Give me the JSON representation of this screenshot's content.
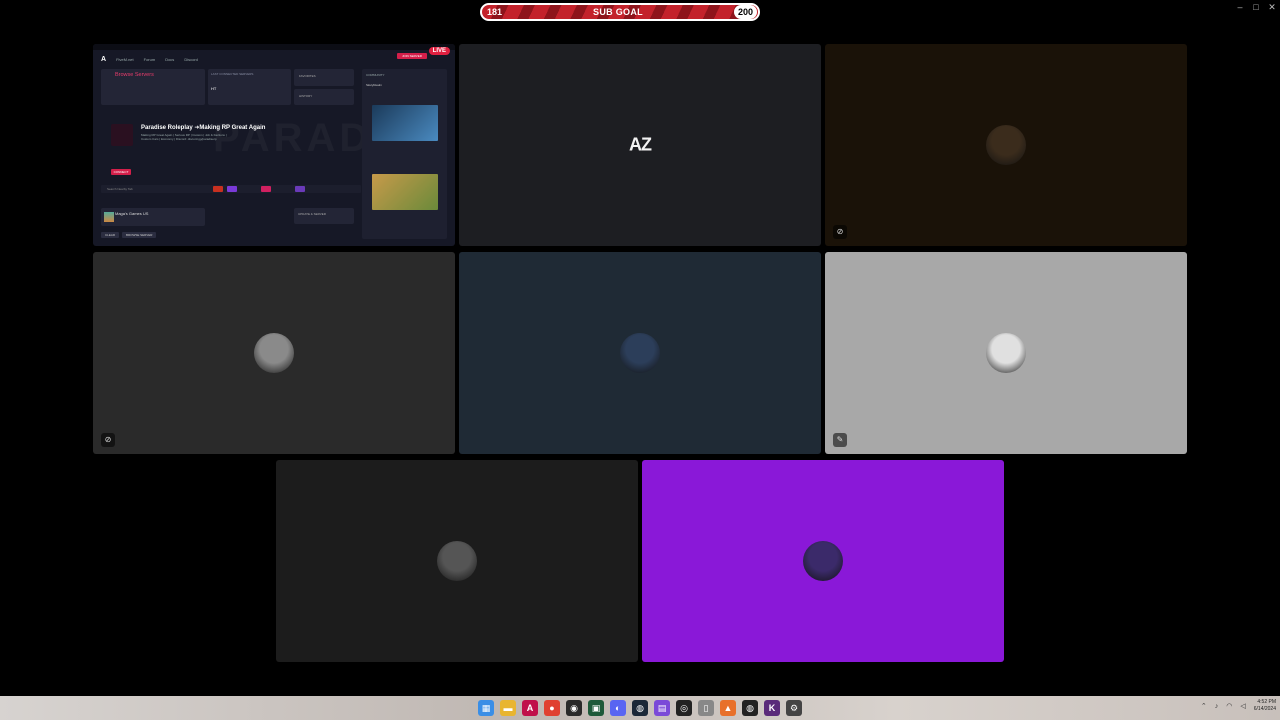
{
  "subgoal": {
    "current": "181",
    "title": "SUB GOAL",
    "target": "200"
  },
  "window_controls": {
    "minimize": "–",
    "maximize": "□",
    "close": "✕"
  },
  "screen_share": {
    "live_badge": "LIVE",
    "nav": [
      "FiveM.net",
      "Forum",
      "Docs",
      "Discord"
    ],
    "join_label": "JOIN SERVER",
    "browse_label": "Browse Servers",
    "recent_title": "LAST CONNECTED SERVERS",
    "recent_item": "HT",
    "small_panel_1": "FAVORITES",
    "small_panel_2": "HISTORY",
    "server_name": "Paradise Roleplay ➜Making RP Great Again",
    "server_desc": "Making RP Great Again | Serious RP | Custom | Job & Factions | Custom Cars | Economy | Discord: discord.gg/paradiserp",
    "bg_word": "PARADISE",
    "connect_label": "CONNECT",
    "search_placeholder": "Search Nearby Tab",
    "favorite_name": "Maga's Games US",
    "update_label": "UPDATE & SERVER",
    "buttons": [
      "CLEAR",
      "BROWSE SERVER"
    ],
    "news_title": "COMMUNITY",
    "news_author": "SkulyRealm"
  },
  "tiles": [
    {
      "name": "tile-screen-share",
      "bg": "#161826"
    },
    {
      "name": "tile-az",
      "bg": "#1d1e22",
      "logo": "AZ"
    },
    {
      "name": "tile-user-1",
      "bg": "#1a1208",
      "avatar_color": "#3b2c1c",
      "muted": true
    },
    {
      "name": "tile-user-2",
      "bg": "#2a2a2a",
      "avatar_color": "#8a8a8a",
      "muted": true
    },
    {
      "name": "tile-user-3",
      "bg": "#1f2a35",
      "avatar_color": "#2c3e5a",
      "muted": false
    },
    {
      "name": "tile-user-4",
      "bg": "#a8a8a8",
      "avatar_color": "#e0e0e0",
      "muted": true
    },
    {
      "name": "tile-user-5",
      "bg": "#1c1c1c",
      "avatar_color": "#555555",
      "muted": false
    },
    {
      "name": "tile-user-6",
      "bg": "#8a18d8",
      "avatar_color": "#3b2a6a",
      "muted": false
    }
  ],
  "taskbar": {
    "icons": [
      {
        "name": "widgets-icon",
        "glyph": "▦",
        "color": "#3a8ee6"
      },
      {
        "name": "file-explorer-icon",
        "glyph": "▬",
        "color": "#e8b530"
      },
      {
        "name": "app-a-icon",
        "glyph": "A",
        "color": "#c0104a"
      },
      {
        "name": "chrome-icon",
        "glyph": "●",
        "color": "#e04030"
      },
      {
        "name": "obs-icon",
        "glyph": "◉",
        "color": "#2a2a2a"
      },
      {
        "name": "terminal-icon",
        "glyph": "▣",
        "color": "#1e5a3a"
      },
      {
        "name": "discord-icon",
        "glyph": "◐",
        "color": "#5865f2"
      },
      {
        "name": "steam-icon",
        "glyph": "◍",
        "color": "#1b2838"
      },
      {
        "name": "twitch-icon",
        "glyph": "▤",
        "color": "#7a4ad8"
      },
      {
        "name": "github-icon",
        "glyph": "◎",
        "color": "#222222"
      },
      {
        "name": "mouse-icon",
        "glyph": "▯",
        "color": "#888888"
      },
      {
        "name": "fire-icon",
        "glyph": "▲",
        "color": "#e8702a"
      },
      {
        "name": "steelseries-icon",
        "glyph": "◍",
        "color": "#222222"
      },
      {
        "name": "kick-icon",
        "glyph": "K",
        "color": "#5a2a7a"
      },
      {
        "name": "settings-icon",
        "glyph": "⚙",
        "color": "#444444"
      }
    ],
    "time": "4:52 PM",
    "date": "6/14/2024"
  }
}
